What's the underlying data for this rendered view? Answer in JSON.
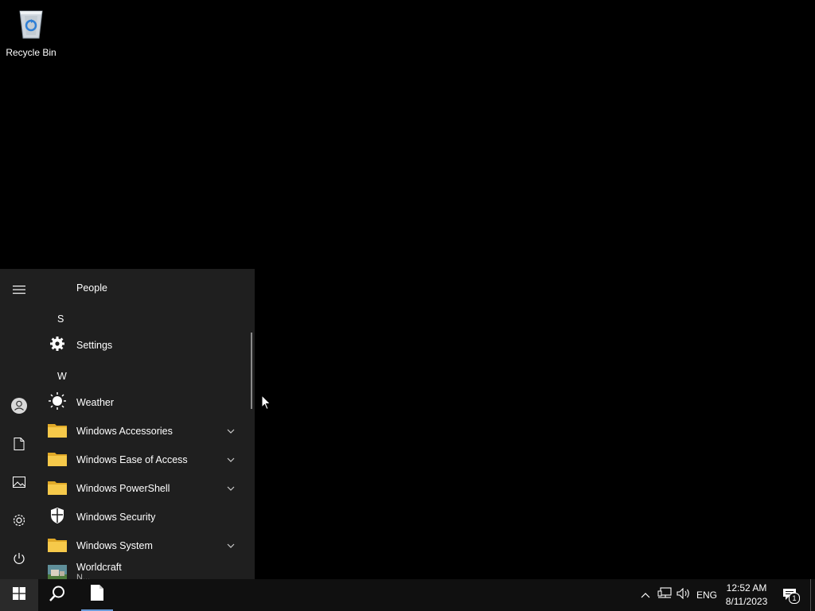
{
  "desktop": {
    "icons": [
      {
        "label": "Recycle Bin",
        "icon": "recycle-bin-icon"
      }
    ]
  },
  "start_menu": {
    "rail": [
      {
        "name": "expand",
        "icon": "hamburger-menu-icon"
      },
      {
        "name": "account",
        "icon": "user-account-icon"
      },
      {
        "name": "documents",
        "icon": "document-icon"
      },
      {
        "name": "pictures",
        "icon": "pictures-icon"
      },
      {
        "name": "settings",
        "icon": "gear-icon"
      },
      {
        "name": "power",
        "icon": "power-icon"
      }
    ],
    "apps": {
      "people": "People",
      "letter_s": "S",
      "settings": "Settings",
      "letter_w": "W",
      "weather": "Weather",
      "win_accessories": "Windows Accessories",
      "win_ease": "Windows Ease of Access",
      "win_powershell": "Windows PowerShell",
      "win_security": "Windows Security",
      "win_system": "Windows System",
      "worldcraft": "Worldcraft",
      "worldcraft_sub": "N..."
    }
  },
  "taskbar": {
    "start": "windows-start-icon",
    "search": "search-icon",
    "pinned_app": "file-icon",
    "tray": {
      "language": "ENG",
      "time": "12:52 AM",
      "date": "8/11/2023",
      "notifications_count": "1"
    }
  },
  "colors": {
    "desktop_bg": "#000000",
    "start_menu_bg": "#1f1f1f",
    "taskbar_bg": "#101010",
    "folder_yellow": "#f3c242"
  }
}
